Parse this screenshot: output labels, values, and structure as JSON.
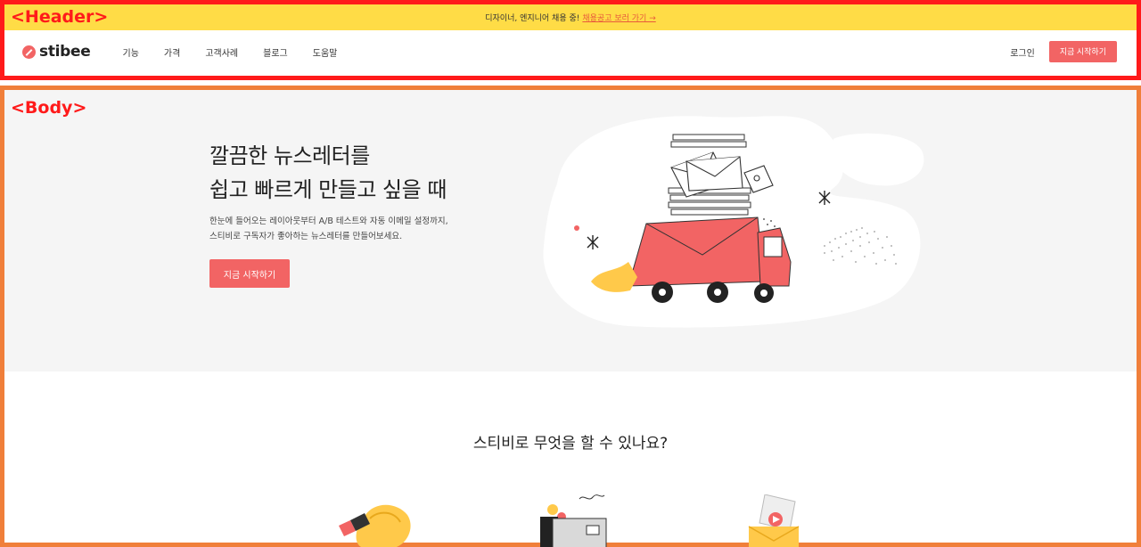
{
  "annotations": {
    "header_label": "<Header>",
    "body_label": "<Body>"
  },
  "banner": {
    "text": "디자이너, 엔지니어 채용 중!",
    "link": "채용공고 보러 가기 →"
  },
  "nav": {
    "logo": "stibee",
    "menu": [
      "기능",
      "가격",
      "고객사례",
      "블로그",
      "도움말"
    ],
    "login": "로그인",
    "cta": "지금 시작하기"
  },
  "hero": {
    "title_line1": "깔끔한 뉴스레터를",
    "title_line2": "쉽고 빠르게 만들고 싶을 때",
    "desc_line1": "한눈에 들어오는 레이아웃부터 A/B 테스트와 자동 이메일 설정까지,",
    "desc_line2": "스티비로 구독자가 좋아하는 뉴스레터를 만들어보세요.",
    "cta": "지금 시작하기"
  },
  "features": {
    "title": "스티비로 무엇을 할 수 있나요?"
  },
  "colors": {
    "accent": "#f26464",
    "banner": "#ffdc46",
    "hero_bg": "#f5f5f5",
    "annotation_header": "#ff1a1a",
    "annotation_body": "#f07f3a"
  }
}
